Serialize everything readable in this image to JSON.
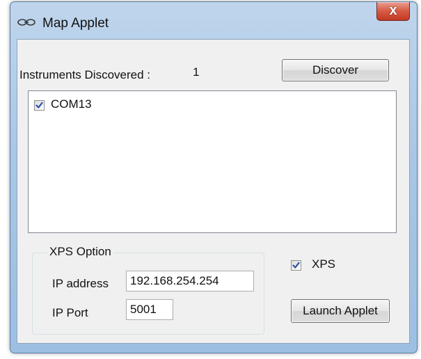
{
  "window": {
    "title": "Map Applet",
    "close_glyph": "x"
  },
  "discovery": {
    "label": "Instruments Discovered :",
    "count": "1",
    "discover_button": "Discover",
    "instruments": [
      {
        "name": "COM13",
        "checked": true
      }
    ]
  },
  "xps_option": {
    "group_title": "XPS Option",
    "ip_label": "IP address",
    "ip_value": "192.168.254.254",
    "port_label": "IP Port",
    "port_value": "5001"
  },
  "xps_checkbox": {
    "label": "XPS",
    "checked": true
  },
  "launch_button": "Launch Applet",
  "icons": {
    "app_icon": "link-chain-icon",
    "check": "checkmark-icon"
  },
  "colors": {
    "frame": "#a9c6e6",
    "close_button": "#c84a32",
    "dialog_bg": "#f0f0f0",
    "check_mark": "#2b4fa3"
  }
}
